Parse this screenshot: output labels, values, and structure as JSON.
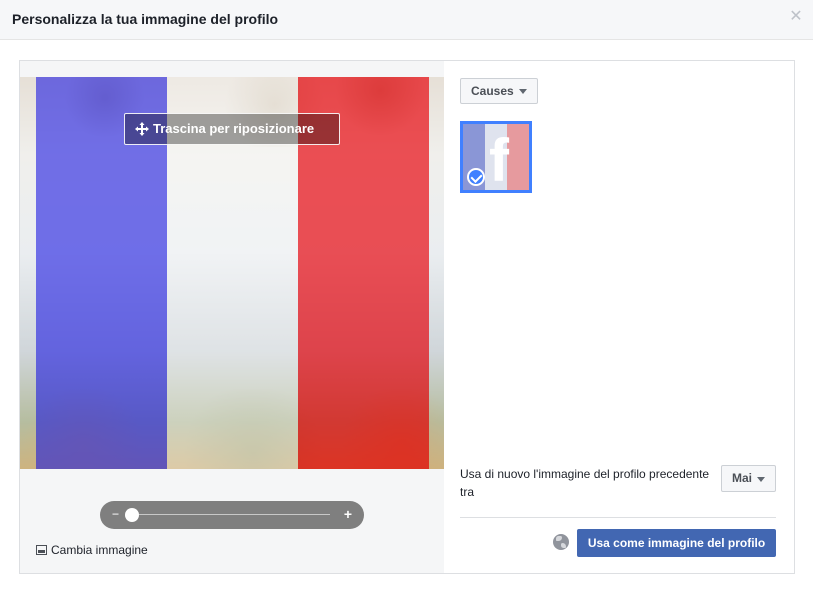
{
  "dialog": {
    "title": "Personalizza la tua immagine del profilo",
    "close_icon": "close-icon"
  },
  "editor": {
    "drag_label": "Trascina per riposizionare",
    "drag_icon": "move-icon",
    "flag_colors": {
      "blue": "#4240e8",
      "white": "#ffffff",
      "red": "#ec141c"
    },
    "zoom": {
      "minus_label": "−",
      "plus_label": "+",
      "level": 0.04
    },
    "change_image_label": "Cambia immagine",
    "change_image_icon": "picture-icon"
  },
  "frames": {
    "category_label": "Causes",
    "selected_frame": {
      "name": "facebook-france-flag-frame",
      "selected": true
    }
  },
  "settings": {
    "reuse_text": "Usa di nuovo l'immagine del profilo precedente tra",
    "reuse_value": "Mai"
  },
  "footer": {
    "privacy_icon": "globe-icon",
    "primary_label": "Usa come immagine del profilo",
    "primary_color": "#4267b2"
  }
}
